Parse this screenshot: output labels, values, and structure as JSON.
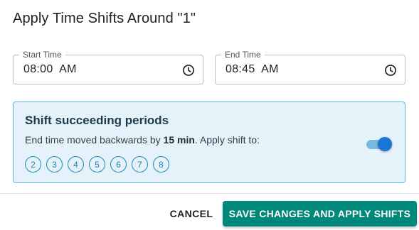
{
  "dialog": {
    "title": "Apply Time Shifts Around \"1\""
  },
  "start_time": {
    "label": "Start Time",
    "value": "08:00  AM",
    "icon": "clock-icon"
  },
  "end_time": {
    "label": "End Time",
    "value": "08:45  AM",
    "icon": "clock-icon"
  },
  "shift_panel": {
    "title": "Shift succeeding periods",
    "desc_prefix": "End time moved backwards by ",
    "desc_amount": "15 min",
    "desc_suffix": ". Apply shift to:",
    "periods": [
      "2",
      "3",
      "4",
      "5",
      "6",
      "7",
      "8"
    ],
    "toggle_on": true,
    "accent_color": "#1976d2",
    "panel_bg": "#e6f2fa",
    "panel_border": "#5bb5df"
  },
  "actions": {
    "cancel_label": "CANCEL",
    "save_label": "SAVE CHANGES AND APPLY SHIFTS",
    "primary_color": "#00897b"
  }
}
